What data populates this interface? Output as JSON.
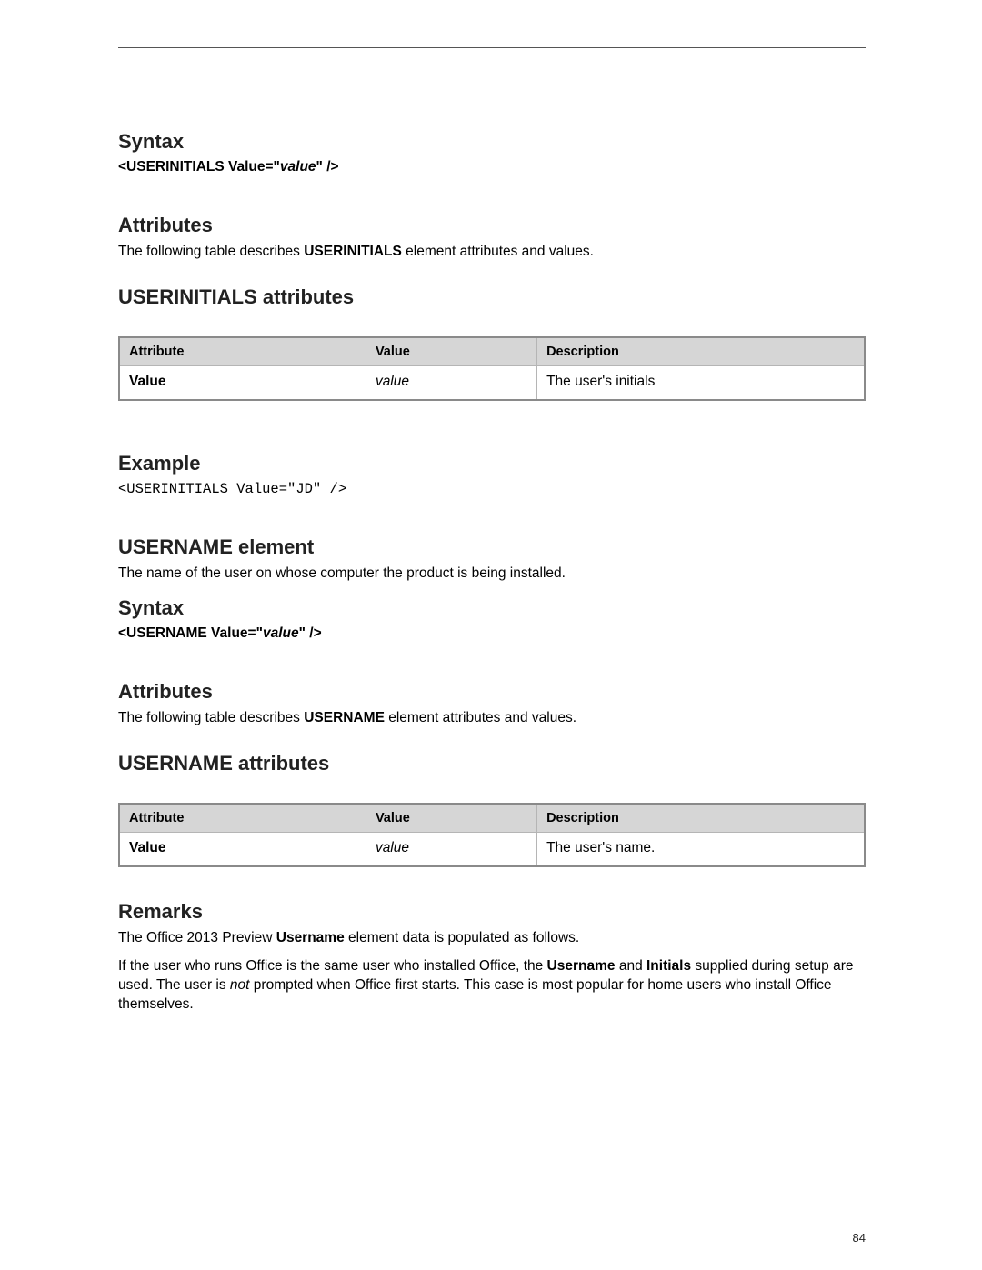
{
  "page_number": "84",
  "userinitials": {
    "syntax": {
      "heading": "Syntax",
      "prefix": "<USERINITIALS Value=\"",
      "placeholder": "value",
      "suffix": "\" />"
    },
    "attributes": {
      "heading": "Attributes",
      "intro_before": "The following table describes ",
      "intro_bold": "USERINITIALS",
      "intro_after": " element attributes and values."
    },
    "table": {
      "heading": "USERINITIALS attributes",
      "headers": {
        "c1": "Attribute",
        "c2": "Value",
        "c3": "Description"
      },
      "row": {
        "attribute": "Value",
        "value": "value",
        "description": "The user's initials"
      }
    },
    "example": {
      "heading": "Example",
      "code": "<USERINITIALS Value=\"JD\" />"
    }
  },
  "username": {
    "element": {
      "heading": "USERNAME element",
      "intro": "The name of the user on whose computer the product is being installed."
    },
    "syntax": {
      "heading": "Syntax",
      "prefix": "<USERNAME Value=\"",
      "placeholder": "value",
      "suffix": "\" />"
    },
    "attributes": {
      "heading": "Attributes",
      "intro_before": "The following table describes ",
      "intro_bold": "USERNAME",
      "intro_after": " element attributes and values."
    },
    "table": {
      "heading": "USERNAME attributes",
      "headers": {
        "c1": "Attribute",
        "c2": "Value",
        "c3": "Description"
      },
      "row": {
        "attribute": "Value",
        "value": "value",
        "description": "The user's name."
      }
    }
  },
  "remarks": {
    "heading": "Remarks",
    "p1_before": "The Office 2013 Preview  ",
    "p1_bold": "Username",
    "p1_after": " element data is populated as follows.",
    "p2_a": "If the user who runs Office is the same user who installed Office, the ",
    "p2_b1": "Username",
    "p2_b": " and ",
    "p2_b2": "Initials",
    "p2_c": " supplied during setup are used. The user is ",
    "p2_i": "not",
    "p2_d": " prompted when Office first starts. This case is most popular for home users who install Office themselves."
  }
}
